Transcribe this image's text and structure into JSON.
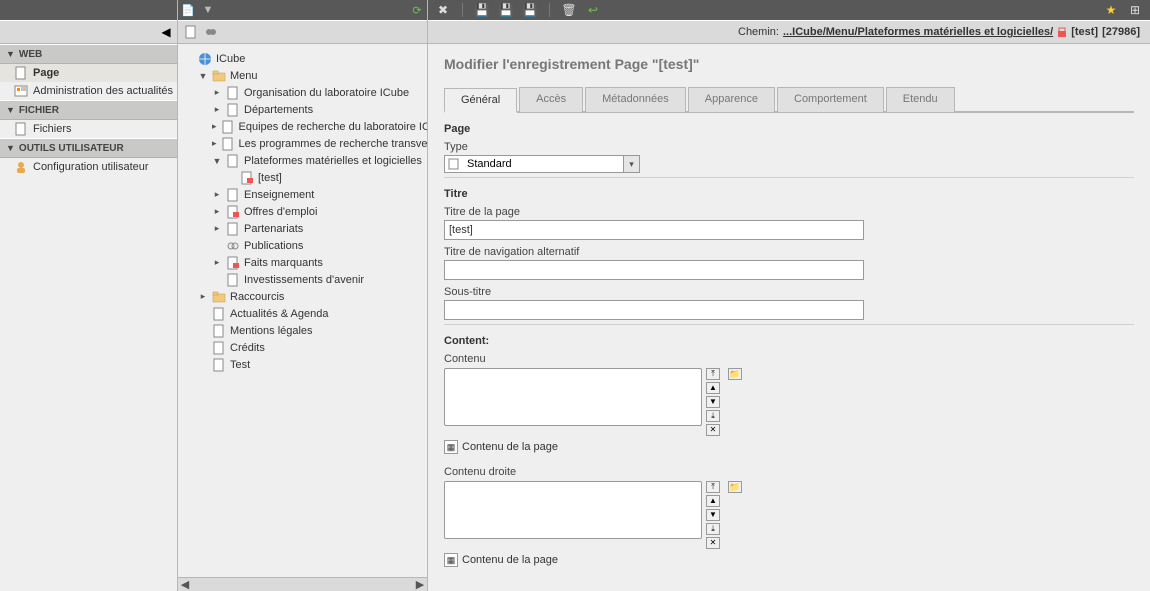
{
  "left": {
    "groups": [
      {
        "title": "WEB",
        "items": [
          {
            "key": "page",
            "label": "Page",
            "icon": "page",
            "selected": true
          },
          {
            "key": "news",
            "label": "Administration des actualités",
            "icon": "news"
          }
        ]
      },
      {
        "title": "FICHIER",
        "items": [
          {
            "key": "files",
            "label": "Fichiers",
            "icon": "page"
          }
        ]
      },
      {
        "title": "OUTILS UTILISATEUR",
        "items": [
          {
            "key": "userconf",
            "label": "Configuration utilisateur",
            "icon": "user"
          }
        ]
      }
    ]
  },
  "tree": {
    "root": {
      "label": "ICube",
      "icon": "globe"
    },
    "menu_label": "Menu",
    "menu_children": [
      {
        "label": "Organisation du laboratoire ICube",
        "exp": true
      },
      {
        "label": "Départements",
        "exp": true
      },
      {
        "label": "Equipes de recherche du laboratoire ICube",
        "exp": true
      },
      {
        "label": "Les programmes de recherche transversaux",
        "exp": true
      },
      {
        "label": "Plateformes matérielles et logicielles",
        "exp": true,
        "open": true,
        "child": {
          "label": "[test]",
          "icon": "lock"
        }
      },
      {
        "label": "Enseignement",
        "exp": true
      },
      {
        "label": "Offres d'emploi",
        "exp": true,
        "icon": "lock"
      },
      {
        "label": "Partenariats",
        "exp": true
      },
      {
        "label": "Publications",
        "icon": "link"
      },
      {
        "label": "Faits marquants",
        "exp": true,
        "icon": "lock"
      },
      {
        "label": "Investissements d'avenir"
      }
    ],
    "siblings": [
      {
        "label": "Raccourcis",
        "icon": "folder",
        "exp": true
      },
      {
        "label": "Actualités & Agenda"
      },
      {
        "label": "Mentions légales"
      },
      {
        "label": "Crédits"
      },
      {
        "label": "Test"
      }
    ]
  },
  "path": {
    "prefix": "Chemin:",
    "link": "...ICube/Menu/Plateformes matérielles et logicielles/",
    "current": "[test]",
    "id": "[27986]"
  },
  "heading": "Modifier l'enregistrement Page \"[test]\"",
  "tabs": [
    "Général",
    "Accès",
    "Métadonnées",
    "Apparence",
    "Comportement",
    "Etendu"
  ],
  "form": {
    "section_page": "Page",
    "type_label": "Type",
    "type_value": "Standard",
    "section_title": "Titre",
    "pagetitle_label": "Titre de la page",
    "pagetitle_value": "[test]",
    "navtitle_label": "Titre de navigation alternatif",
    "navtitle_value": "",
    "subtitle_label": "Sous-titre",
    "subtitle_value": "",
    "section_content": "Content:",
    "content_label": "Contenu",
    "content_right_label": "Contenu droite",
    "content_opt": "Contenu de la page"
  }
}
